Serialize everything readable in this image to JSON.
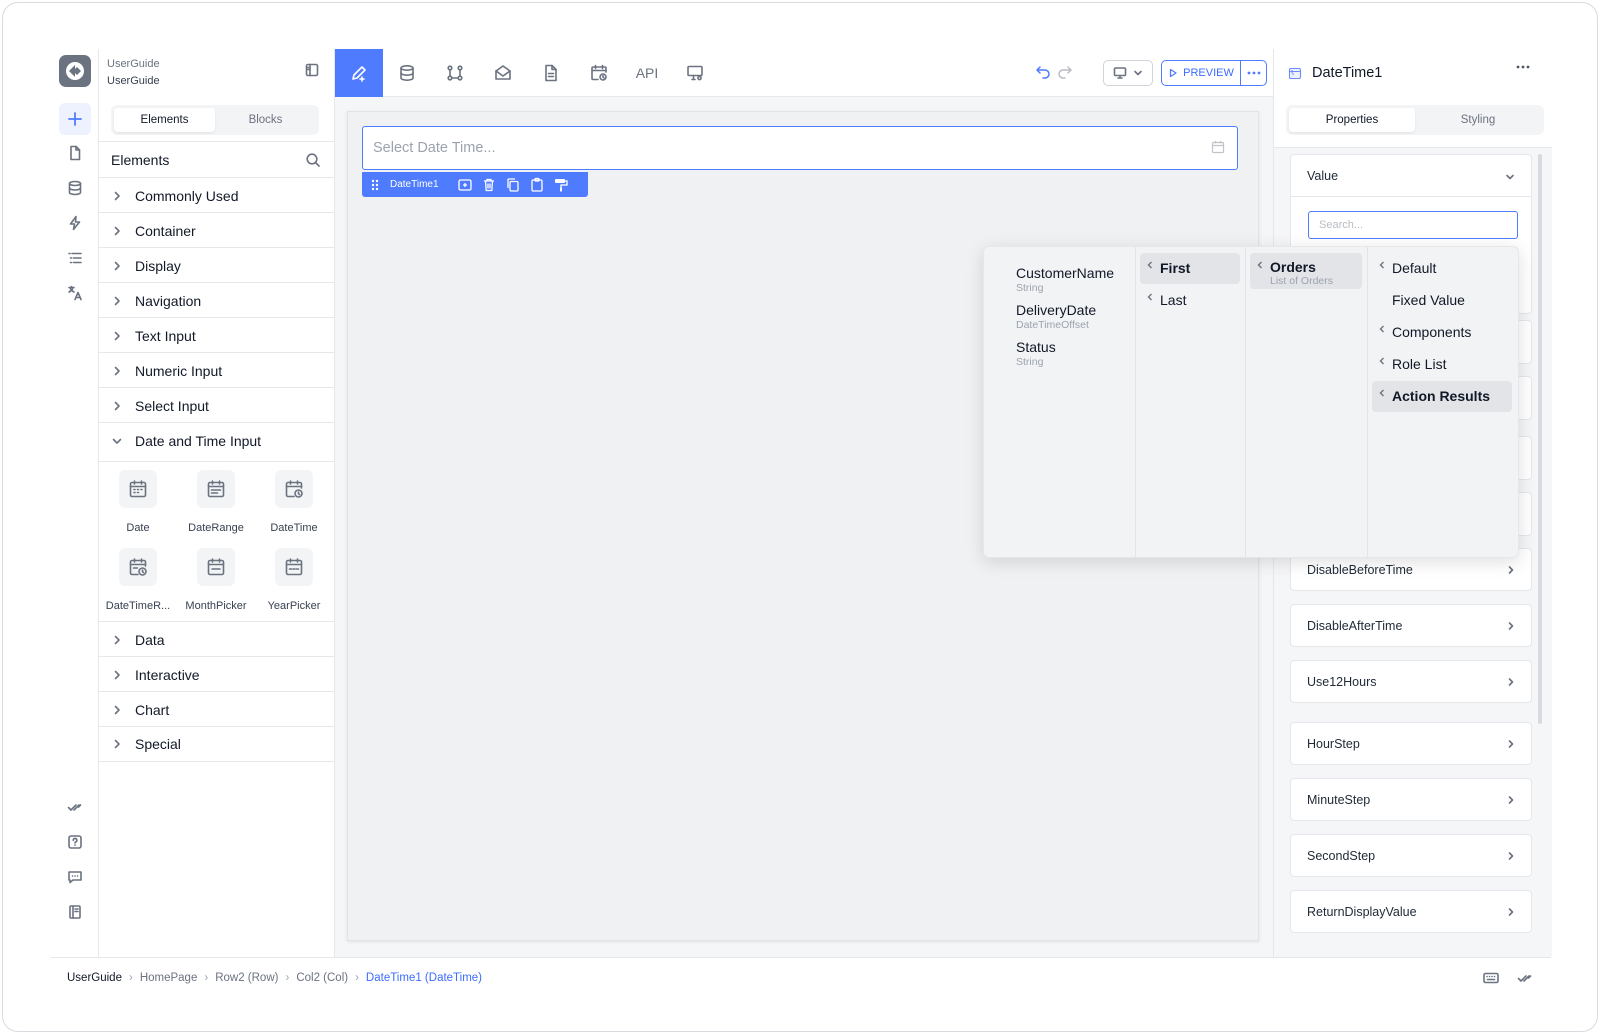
{
  "app": {
    "name": "UserGuide",
    "project": "UserGuide"
  },
  "left_panel": {
    "tabs": [
      "Elements",
      "Blocks"
    ],
    "active_tab": "Elements",
    "section_title": "Elements",
    "categories_top": [
      "Commonly Used",
      "Container",
      "Display",
      "Navigation",
      "Text Input",
      "Numeric Input",
      "Select Input"
    ],
    "expanded_category": "Date and Time Input",
    "date_items": [
      "Date",
      "DateRange",
      "DateTime",
      "DateTimeR...",
      "MonthPicker",
      "YearPicker"
    ],
    "categories_bottom": [
      "Data",
      "Interactive",
      "Chart",
      "Special"
    ]
  },
  "toolbar": {
    "api_label": "API",
    "preview_label": "PREVIEW",
    "accent": "#4f7cff"
  },
  "canvas": {
    "input_placeholder": "Select Date Time...",
    "selected_component": "DateTime1"
  },
  "right_panel": {
    "title": "DateTime1",
    "tabs": [
      "Properties",
      "Styling"
    ],
    "active_tab": "Properties",
    "value_section": "Value",
    "search_placeholder": "Search...",
    "properties": [
      "DisableBeforeTime",
      "DisableAfterTime",
      "Use12Hours",
      "HourStep",
      "MinuteStep",
      "SecondStep",
      "ReturnDisplayValue"
    ]
  },
  "dropdown": {
    "fields": [
      {
        "name": "CustomerName",
        "type": "String"
      },
      {
        "name": "DeliveryDate",
        "type": "DateTimeOffset"
      },
      {
        "name": "Status",
        "type": "String"
      }
    ],
    "selectors": [
      "First",
      "Last"
    ],
    "selected_selector": "First",
    "collection": {
      "name": "Orders",
      "sub": "List of Orders"
    },
    "sources": [
      "Default",
      "Fixed Value",
      "Components",
      "Role List",
      "Action Results"
    ],
    "selected_source": "Action Results"
  },
  "breadcrumb": [
    "UserGuide",
    "HomePage",
    "Row2 (Row)",
    "Col2 (Col)",
    "DateTime1 (DateTime)"
  ]
}
